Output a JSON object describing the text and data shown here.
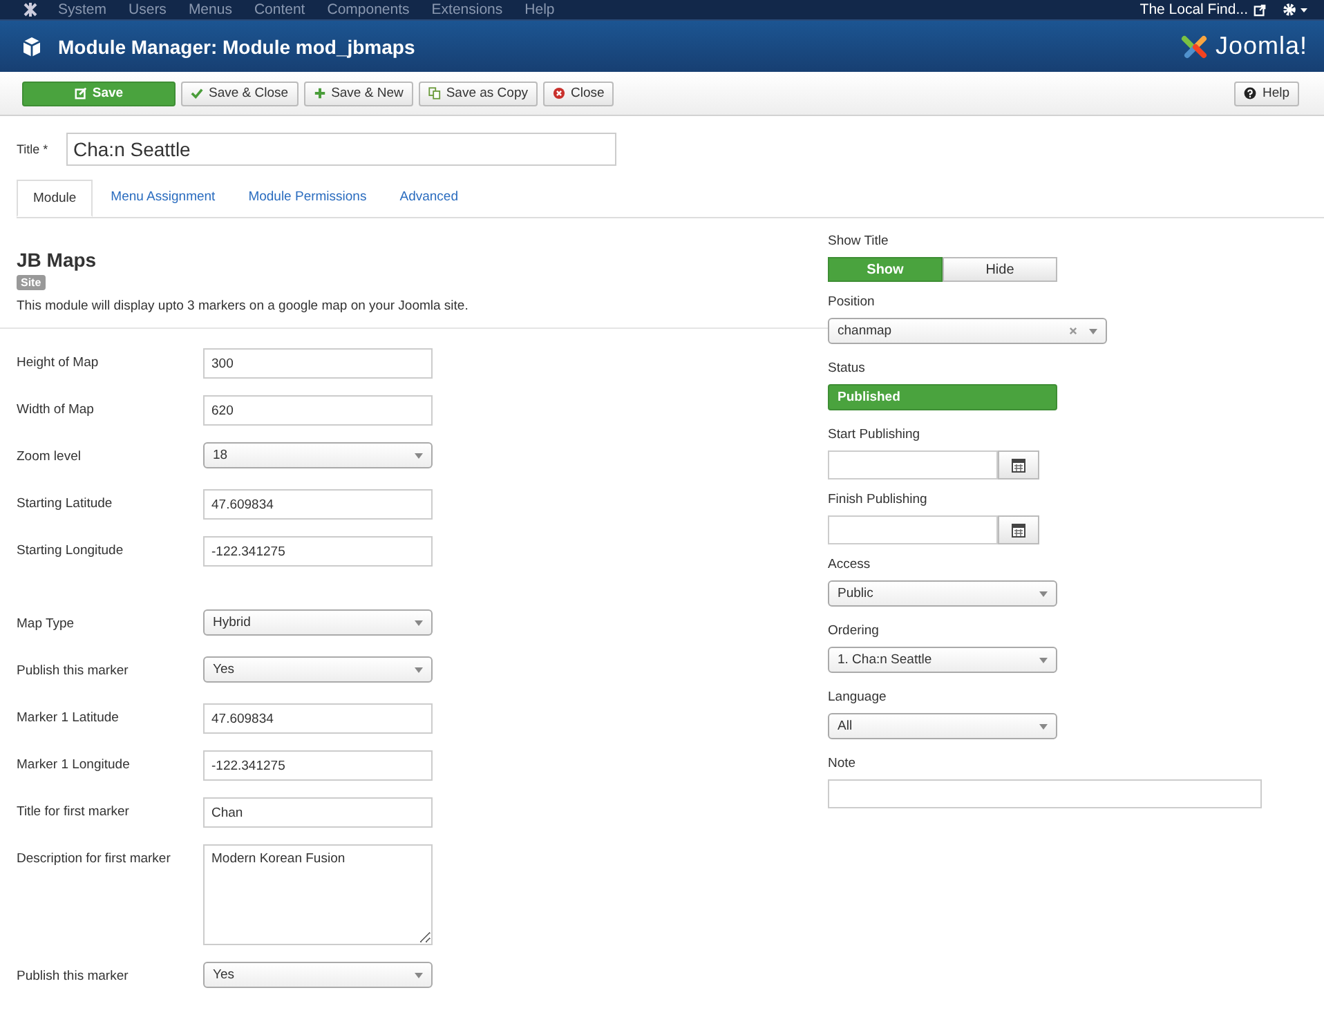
{
  "top_menu": {
    "items": [
      "System",
      "Users",
      "Menus",
      "Content",
      "Components",
      "Extensions",
      "Help"
    ],
    "site_link": "The Local Find..."
  },
  "header": {
    "title": "Module Manager: Module mod_jbmaps",
    "logo_text": "Joomla!"
  },
  "toolbar": {
    "buttons": [
      {
        "label": "Save",
        "kind": "primary"
      },
      {
        "label": "Save & Close",
        "kind": "default"
      },
      {
        "label": "Save & New",
        "kind": "default"
      },
      {
        "label": "Save as Copy",
        "kind": "default"
      },
      {
        "label": "Close",
        "kind": "default"
      }
    ],
    "help": "Help"
  },
  "title_field": {
    "label": "Title",
    "required_mark": "*",
    "value": "Cha:n Seattle"
  },
  "tabs": [
    {
      "label": "Module",
      "selected": true
    },
    {
      "label": "Menu Assignment",
      "selected": false
    },
    {
      "label": "Module Permissions",
      "selected": false
    },
    {
      "label": "Advanced",
      "selected": false
    }
  ],
  "module": {
    "name": "JB Maps",
    "badge": "Site",
    "description": "This module will display upto 3 markers on a google map on your Joomla site."
  },
  "field_groups": [
    [
      {
        "label": "Height of Map",
        "kind": "text",
        "value": "300"
      },
      {
        "label": "Width of Map",
        "kind": "text",
        "value": "620"
      },
      {
        "label": "Zoom level",
        "kind": "select",
        "value": "18"
      },
      {
        "label": "Starting Latitude",
        "kind": "text",
        "value": "47.609834"
      },
      {
        "label": "Starting Longitude",
        "kind": "text",
        "value": "-122.341275"
      }
    ],
    [
      {
        "label": "Map Type",
        "kind": "select",
        "value": "Hybrid"
      },
      {
        "label": "Publish this marker",
        "kind": "select",
        "value": "Yes"
      },
      {
        "label": "Marker 1 Latitude",
        "kind": "text",
        "value": "47.609834"
      },
      {
        "label": "Marker 1 Longitude",
        "kind": "text",
        "value": "-122.341275"
      },
      {
        "label": "Title for first marker",
        "kind": "text",
        "value": "Chan"
      },
      {
        "label": "Description for first marker",
        "kind": "textarea",
        "value": "Modern Korean Fusion"
      },
      {
        "label": "Publish this marker",
        "kind": "select",
        "value": "Yes"
      }
    ]
  ],
  "options": [
    {
      "label": "Show Title",
      "kind": "toggle",
      "choices": [
        {
          "label": "Show",
          "selected": true
        },
        {
          "label": "Hide",
          "selected": false
        }
      ]
    },
    {
      "label": "Position",
      "kind": "chosen",
      "value": "chanmap"
    },
    {
      "label": "Status",
      "kind": "status",
      "value": "Published"
    },
    {
      "label": "Start Publishing",
      "kind": "date"
    },
    {
      "label": "Finish Publishing",
      "kind": "date"
    },
    {
      "label": "Access",
      "kind": "select",
      "value": "Public"
    },
    {
      "label": "Ordering",
      "kind": "select",
      "value": "1. Cha:n Seattle"
    },
    {
      "label": "Language",
      "kind": "select",
      "value": "All"
    },
    {
      "label": "Note",
      "kind": "text"
    }
  ]
}
